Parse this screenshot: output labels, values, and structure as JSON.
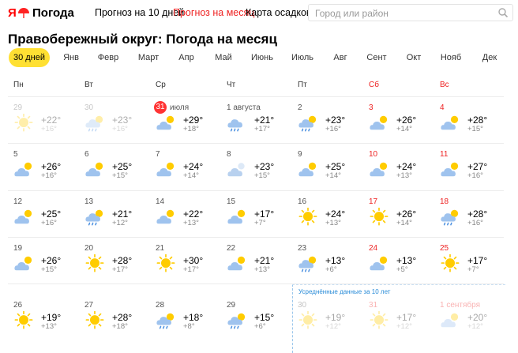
{
  "header": {
    "logo_ya": "Я",
    "logo_text": "Погода",
    "nav": [
      {
        "label": "Прогноз на 10 дней",
        "active": false
      },
      {
        "label": "Прогноз на месяц",
        "active": true
      },
      {
        "label": "Карта осадков",
        "active": false
      }
    ],
    "search_placeholder": "Город или район"
  },
  "title": "Правобережный округ: Погода на месяц",
  "tabs": [
    "30 дней",
    "Янв",
    "Февр",
    "Март",
    "Апр",
    "Май",
    "Июнь",
    "Июль",
    "Авг",
    "Сент",
    "Окт",
    "Нояб",
    "Дек"
  ],
  "active_tab": 0,
  "weekdays": [
    "Пн",
    "Вт",
    "Ср",
    "Чт",
    "Пт",
    "Сб",
    "Вс"
  ],
  "average_label": "Усреднённые данные за 10 лет",
  "colors": {
    "accent": "#ffe033",
    "weekend": "#e22222",
    "today_badge": "#ff3333"
  },
  "weeks": [
    [
      {
        "day": "29",
        "icon": "sun-icon",
        "hi": "+22°",
        "lo": "+16°",
        "state": "past"
      },
      {
        "day": "30",
        "icon": "cloud-rain-icon",
        "hi": "+23°",
        "lo": "+16°",
        "state": "past"
      },
      {
        "day": "31",
        "extra": "июля",
        "icon": "partly-cloudy-icon",
        "hi": "+29°",
        "lo": "+18°",
        "state": "today"
      },
      {
        "day": "1 августа",
        "icon": "rain-icon",
        "hi": "+21°",
        "lo": "+17°"
      },
      {
        "day": "2",
        "icon": "cloud-rain-icon",
        "hi": "+23°",
        "lo": "+16°"
      },
      {
        "day": "3",
        "icon": "partly-cloudy-icon",
        "hi": "+26°",
        "lo": "+14°"
      },
      {
        "day": "4",
        "icon": "partly-cloudy-icon",
        "hi": "+28°",
        "lo": "+15°"
      }
    ],
    [
      {
        "day": "5",
        "icon": "partly-cloudy-icon",
        "hi": "+26°",
        "lo": "+16°"
      },
      {
        "day": "6",
        "icon": "partly-cloudy-icon",
        "hi": "+25°",
        "lo": "+15°"
      },
      {
        "day": "7",
        "icon": "partly-cloudy-icon",
        "hi": "+24°",
        "lo": "+14°"
      },
      {
        "day": "8",
        "icon": "cloudy-icon",
        "hi": "+23°",
        "lo": "+15°"
      },
      {
        "day": "9",
        "icon": "partly-cloudy-icon",
        "hi": "+25°",
        "lo": "+14°"
      },
      {
        "day": "10",
        "icon": "partly-cloudy-icon",
        "hi": "+24°",
        "lo": "+13°"
      },
      {
        "day": "11",
        "icon": "partly-cloudy-icon",
        "hi": "+27°",
        "lo": "+16°"
      }
    ],
    [
      {
        "day": "12",
        "icon": "partly-cloudy-icon",
        "hi": "+25°",
        "lo": "+16°"
      },
      {
        "day": "13",
        "icon": "sun-rain-icon",
        "hi": "+21°",
        "lo": "+12°"
      },
      {
        "day": "14",
        "icon": "partly-cloudy-icon",
        "hi": "+22°",
        "lo": "+13°"
      },
      {
        "day": "15",
        "icon": "partly-cloudy-icon",
        "hi": "+17°",
        "lo": "+7°"
      },
      {
        "day": "16",
        "icon": "sun-icon",
        "hi": "+24°",
        "lo": "+13°"
      },
      {
        "day": "17",
        "icon": "sun-icon",
        "hi": "+26°",
        "lo": "+14°"
      },
      {
        "day": "18",
        "icon": "sun-rain-icon",
        "hi": "+28°",
        "lo": "+16°"
      }
    ],
    [
      {
        "day": "19",
        "icon": "partly-cloudy-icon",
        "hi": "+26°",
        "lo": "+15°"
      },
      {
        "day": "20",
        "icon": "sun-icon",
        "hi": "+28°",
        "lo": "+17°"
      },
      {
        "day": "21",
        "icon": "sun-icon",
        "hi": "+30°",
        "lo": "+17°"
      },
      {
        "day": "22",
        "icon": "partly-cloudy-icon",
        "hi": "+21°",
        "lo": "+13°"
      },
      {
        "day": "23",
        "icon": "sun-rain-icon",
        "hi": "+13°",
        "lo": "+6°"
      },
      {
        "day": "24",
        "icon": "partly-cloudy-icon",
        "hi": "+13°",
        "lo": "+5°"
      },
      {
        "day": "25",
        "icon": "sun-icon",
        "hi": "+17°",
        "lo": "+7°"
      }
    ],
    [
      {
        "day": "26",
        "icon": "sun-icon",
        "hi": "+19°",
        "lo": "+13°"
      },
      {
        "day": "27",
        "icon": "sun-icon",
        "hi": "+28°",
        "lo": "+18°"
      },
      {
        "day": "28",
        "icon": "cloud-rain-icon",
        "hi": "+18°",
        "lo": "+8°"
      },
      {
        "day": "29",
        "icon": "cloud-rain-icon",
        "hi": "+15°",
        "lo": "+6°"
      },
      {
        "day": "30",
        "icon": "sun-icon",
        "hi": "+19°",
        "lo": "+12°",
        "state": "avg"
      },
      {
        "day": "31",
        "icon": "sun-icon",
        "hi": "+17°",
        "lo": "+12°",
        "state": "avg"
      },
      {
        "day": "1 сентября",
        "icon": "partly-cloudy-icon",
        "hi": "+20°",
        "lo": "+12°",
        "state": "avg"
      }
    ]
  ]
}
